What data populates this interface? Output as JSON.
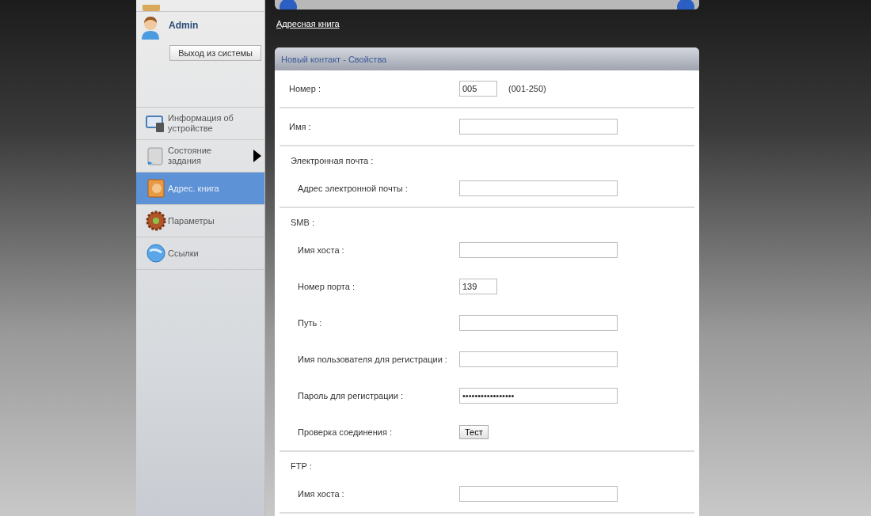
{
  "user": {
    "name": "Admin",
    "logout": "Выход из системы"
  },
  "nav": [
    {
      "label": "Информация об устройстве",
      "selected": false,
      "submenu": false
    },
    {
      "label": "Состояние задания",
      "selected": false,
      "submenu": true
    },
    {
      "label": "Адрес. книга",
      "selected": true,
      "submenu": false
    },
    {
      "label": "Параметры",
      "selected": false,
      "submenu": false
    },
    {
      "label": "Ссылки",
      "selected": false,
      "submenu": false
    }
  ],
  "breadcrumb": "Адресная книга",
  "panel": {
    "title": "Новый контакт - Свойства",
    "sections": [
      {
        "rows": [
          {
            "kind": "short",
            "label": "Номер :",
            "value": "005",
            "hint": "(001-250)"
          }
        ]
      },
      {
        "rows": [
          {
            "kind": "input",
            "label": "Имя :"
          }
        ]
      },
      {
        "heading": "Электронная почта :",
        "rows": [
          {
            "kind": "input",
            "label": "Адрес электронной почты :"
          }
        ]
      },
      {
        "heading": "SMB :",
        "rows": [
          {
            "kind": "input",
            "label": "Имя хоста :"
          },
          {
            "kind": "short",
            "label": "Номер порта :",
            "value": "139"
          },
          {
            "kind": "input",
            "label": "Путь :"
          },
          {
            "kind": "input",
            "label": "Имя пользователя для регистрации :"
          },
          {
            "kind": "input",
            "label": "Пароль для регистрации :",
            "value": "•••••••••••••••••"
          },
          {
            "kind": "button",
            "label": "Проверка соединения :",
            "value": "Тест"
          }
        ]
      },
      {
        "heading": "FTP :",
        "rows": [
          {
            "kind": "input",
            "label": "Имя хоста :"
          }
        ]
      }
    ]
  }
}
